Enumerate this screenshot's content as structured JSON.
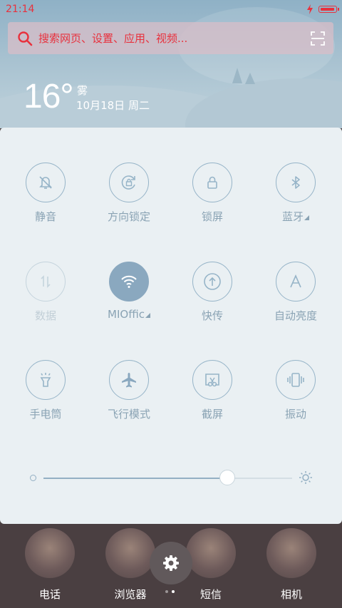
{
  "status": {
    "time": "21:14"
  },
  "search": {
    "placeholder": "搜索网页、设置、应用、视频..."
  },
  "weather": {
    "temperature": "16°",
    "condition": "雾",
    "date": "10月18日 周二"
  },
  "toggles": [
    {
      "label": "静音",
      "icon": "mute-bell-icon",
      "state": "off"
    },
    {
      "label": "方向锁定",
      "icon": "rotation-lock-icon",
      "state": "off"
    },
    {
      "label": "锁屏",
      "icon": "lock-icon",
      "state": "off"
    },
    {
      "label": "蓝牙",
      "icon": "bluetooth-icon",
      "state": "off",
      "has_menu": true
    },
    {
      "label": "数据",
      "icon": "mobile-data-icon",
      "state": "disabled"
    },
    {
      "label": "MIOffic",
      "icon": "wifi-icon",
      "state": "on",
      "has_menu": true
    },
    {
      "label": "快传",
      "icon": "quick-share-icon",
      "state": "off"
    },
    {
      "label": "自动亮度",
      "icon": "auto-brightness-icon",
      "state": "off"
    },
    {
      "label": "手电筒",
      "icon": "flashlight-icon",
      "state": "off"
    },
    {
      "label": "飞行模式",
      "icon": "airplane-icon",
      "state": "off"
    },
    {
      "label": "截屏",
      "icon": "screenshot-icon",
      "state": "off"
    },
    {
      "label": "振动",
      "icon": "vibrate-icon",
      "state": "off"
    }
  ],
  "brightness": {
    "level": 0.74
  },
  "dock": {
    "apps": [
      {
        "label": "电话"
      },
      {
        "label": "浏览器"
      },
      {
        "label": "短信"
      },
      {
        "label": "相机"
      }
    ],
    "page_count": 2,
    "active_page": 1
  },
  "colors": {
    "accent_red": "#e8313d",
    "panel_bg": "#eaf0f3",
    "icon_blue": "#8aa8bf",
    "label_blue": "#8aa3b4"
  }
}
